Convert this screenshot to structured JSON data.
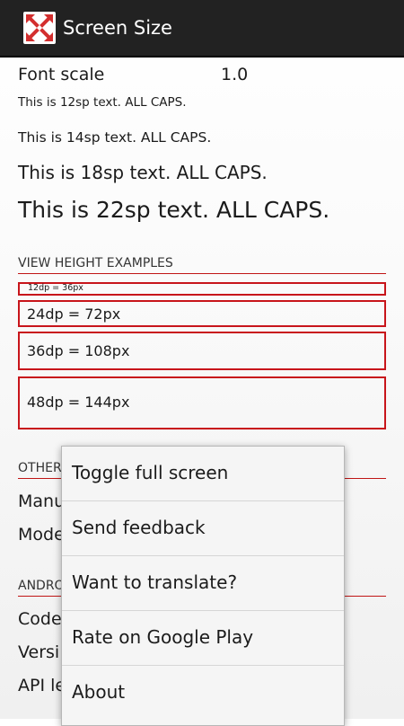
{
  "action_bar": {
    "title": "Screen Size",
    "icon": "expand-arrows-icon",
    "icon_colors": {
      "background": "#ffffff",
      "arrows": "#d32f2f"
    },
    "background": "#222222"
  },
  "font_scale": {
    "label": "Font scale",
    "value": "1.0"
  },
  "text_samples": [
    "This is 12sp text. ALL CAPS.",
    "This is 14sp text. ALL CAPS.",
    "This is 18sp text. ALL CAPS.",
    "This is 22sp text. ALL CAPS."
  ],
  "sections": {
    "view_height": "VIEW HEIGHT EXAMPLES",
    "other": "OTHER",
    "android": "ANDRO"
  },
  "view_height_boxes": [
    "12dp = 36px",
    "24dp = 72px",
    "36dp = 108px",
    "48dp = 144px"
  ],
  "other_rows": [
    "Manu",
    "Mode"
  ],
  "android_rows": [
    "Code",
    "Versi",
    "API le"
  ],
  "menu": {
    "items": [
      "Toggle full screen",
      "Send feedback",
      "Want to translate?",
      "Rate on Google Play",
      "About"
    ]
  },
  "colors": {
    "accent_red": "#c8151b",
    "divider_red": "#c01515"
  }
}
